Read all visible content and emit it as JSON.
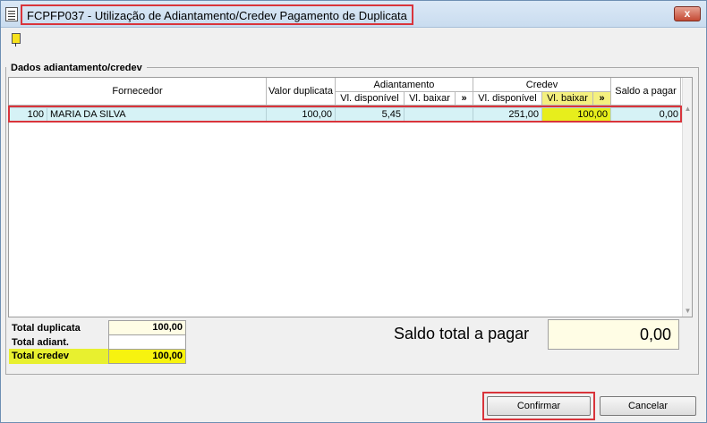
{
  "window": {
    "title": "FCPFP037 - Utilização de Adiantamento/Credev Pagamento de Duplicata",
    "close_label": "x"
  },
  "section": {
    "title": "Dados adiantamento/credev"
  },
  "headers": {
    "fornecedor": "Fornecedor",
    "valor_duplicata": "Valor duplicata",
    "adiantamento": "Adiantamento",
    "adiant_disponivel": "Vl. disponível",
    "adiant_baixar": "Vl. baixar",
    "adiant_arrow": "»",
    "credev": "Credev",
    "credev_disponivel": "Vl. disponível",
    "credev_baixar": "Vl. baixar",
    "credev_arrow": "»",
    "saldo": "Saldo a pagar"
  },
  "rows": [
    {
      "codigo": "100",
      "nome": "MARIA DA SILVA",
      "valor_duplicata": "100,00",
      "adiant_disponivel": "5,45",
      "adiant_baixar": "",
      "credev_disponivel": "251,00",
      "credev_baixar": "100,00",
      "saldo": "0,00"
    }
  ],
  "totals": {
    "duplicata_label": "Total duplicata",
    "duplicata_value": "100,00",
    "adiant_label": "Total adiant.",
    "adiant_value": "",
    "credev_label": "Total credev",
    "credev_value": "100,00"
  },
  "saldo_total": {
    "label": "Saldo total a pagar",
    "value": "0,00"
  },
  "buttons": {
    "confirm": "Confirmar",
    "cancel": "Cancelar"
  }
}
